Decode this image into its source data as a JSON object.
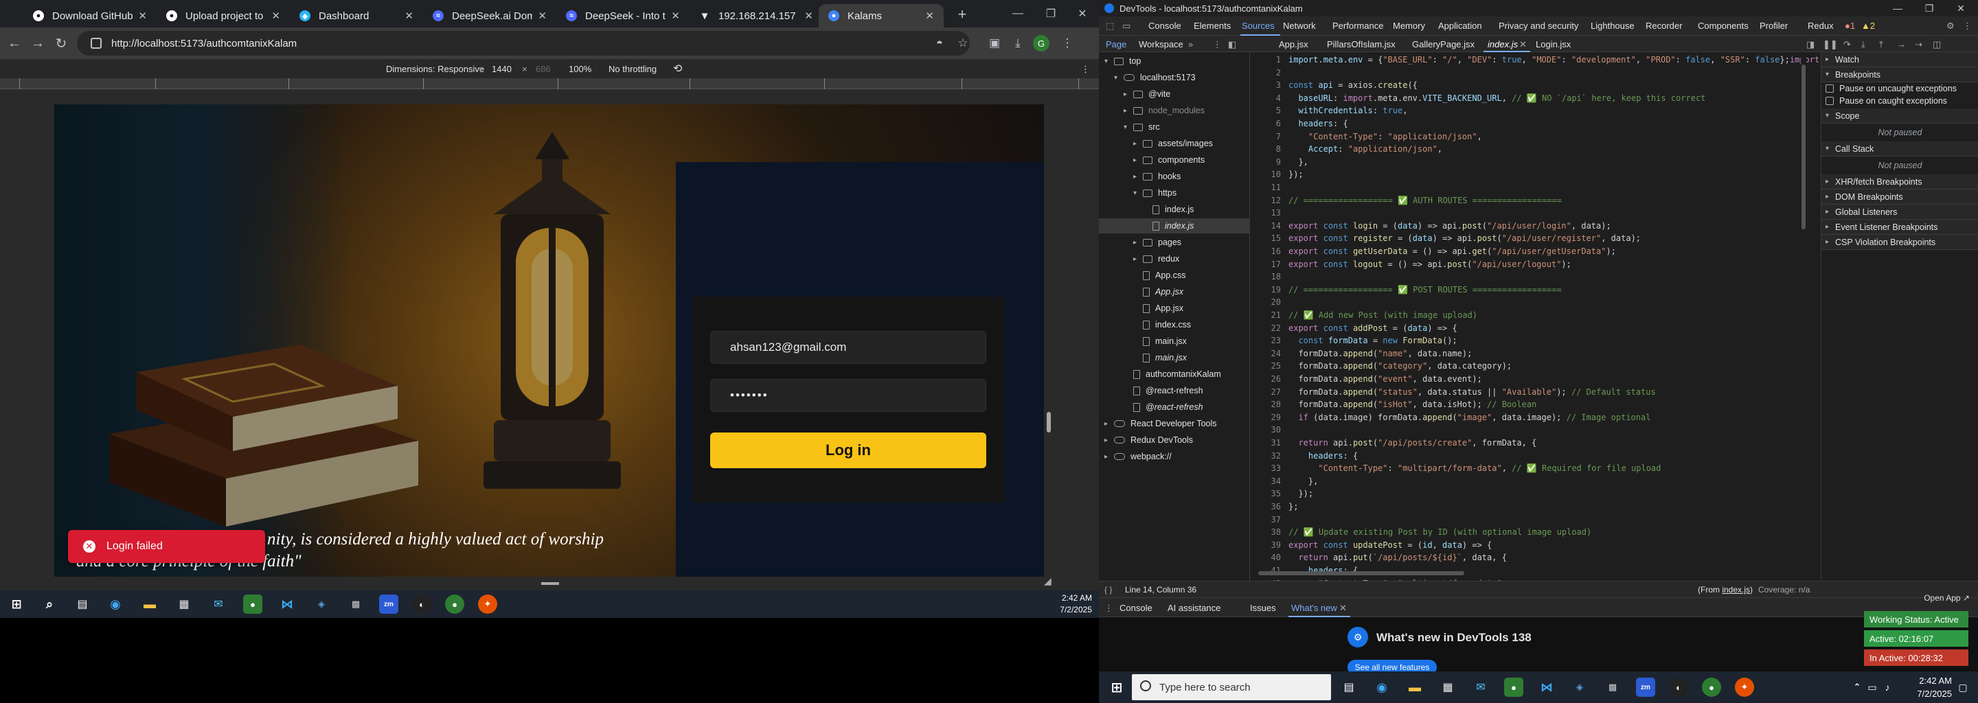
{
  "browser": {
    "tabs": [
      {
        "title": "Download GitHub Des",
        "icon": "github-icon",
        "active": false
      },
      {
        "title": "Upload project to kala",
        "icon": "github-icon",
        "active": false
      },
      {
        "title": "Dashboard",
        "icon": "dashboard-icon",
        "active": false
      },
      {
        "title": "DeepSeek.ai Domain F",
        "icon": "deepseek-icon",
        "active": false
      },
      {
        "title": "DeepSeek - Into the U",
        "icon": "deepseek-icon",
        "active": false
      },
      {
        "title": "192.168.214.157",
        "icon": "wifi-icon",
        "active": false
      },
      {
        "title": "Kalams",
        "icon": "chrome-icon",
        "active": true
      }
    ],
    "new_tab": "+",
    "url": "http://localhost:5173/authcomtanixKalam",
    "profile_initial": "G",
    "emulation": {
      "dimensions": "Dimensions: Responsive",
      "width": "1440",
      "times": "×",
      "height": "686",
      "zoom": "100%",
      "throttling": "No throttling"
    }
  },
  "app": {
    "login": {
      "email_value": "ahsan123@gmail.com",
      "password_value": "•••••••",
      "login_label": "Log in"
    },
    "quote_line1": "nity, is considered a highly valued act of worship",
    "quote_line2": "and a core principle of the faith\"",
    "toast": {
      "icon": "✕",
      "message": "Login failed"
    }
  },
  "left_taskbar": {
    "time": "2:42 AM",
    "date": "7/2/2025"
  },
  "devtools": {
    "window_title": "DevTools - localhost:5173/authcomtanixKalam",
    "panels": [
      "Console",
      "Elements",
      "Sources",
      "Network",
      "Performance",
      "Memory",
      "Application",
      "Privacy and security",
      "Lighthouse",
      "Recorder",
      "Components",
      "Profiler",
      "Redux"
    ],
    "active_panel": "Sources",
    "errors_badge": "1",
    "warnings_badge": "2",
    "nav_tabs": [
      "Page",
      "Workspace"
    ],
    "file_tabs": [
      "App.jsx",
      "PillarsOfIslam.jsx",
      "GalleryPage.jsx",
      "index.js",
      "Login.jsx"
    ],
    "active_file": "index.js",
    "tree": [
      {
        "label": "top",
        "depth": 0,
        "kind": "frame",
        "arrow": "▾"
      },
      {
        "label": "localhost:5173",
        "depth": 1,
        "kind": "cloud",
        "arrow": "▾"
      },
      {
        "label": "@vite",
        "depth": 2,
        "kind": "folder",
        "arrow": "▸"
      },
      {
        "label": "node_modules",
        "depth": 2,
        "kind": "folder",
        "arrow": "▸",
        "dim": true
      },
      {
        "label": "src",
        "depth": 2,
        "kind": "folder",
        "arrow": "▾"
      },
      {
        "label": "assets/images",
        "depth": 3,
        "kind": "folder",
        "arrow": "▸"
      },
      {
        "label": "components",
        "depth": 3,
        "kind": "folder",
        "arrow": "▸"
      },
      {
        "label": "hooks",
        "depth": 3,
        "kind": "folder",
        "arrow": "▸"
      },
      {
        "label": "https",
        "depth": 3,
        "kind": "folder",
        "arrow": "▾"
      },
      {
        "label": "index.js",
        "depth": 4,
        "kind": "file"
      },
      {
        "label": "index.js",
        "depth": 4,
        "kind": "file",
        "italic": true,
        "selected": true
      },
      {
        "label": "pages",
        "depth": 3,
        "kind": "folder",
        "arrow": "▸"
      },
      {
        "label": "redux",
        "depth": 3,
        "kind": "folder",
        "arrow": "▸"
      },
      {
        "label": "App.css",
        "depth": 3,
        "kind": "file"
      },
      {
        "label": "App.jsx",
        "depth": 3,
        "kind": "file",
        "italic": true
      },
      {
        "label": "App.jsx",
        "depth": 3,
        "kind": "file"
      },
      {
        "label": "index.css",
        "depth": 3,
        "kind": "file"
      },
      {
        "label": "main.jsx",
        "depth": 3,
        "kind": "file"
      },
      {
        "label": "main.jsx",
        "depth": 3,
        "kind": "file",
        "italic": true
      },
      {
        "label": "authcomtanixKalam",
        "depth": 2,
        "kind": "file"
      },
      {
        "label": "@react-refresh",
        "depth": 2,
        "kind": "file"
      },
      {
        "label": "@react-refresh",
        "depth": 2,
        "kind": "file",
        "italic": true
      },
      {
        "label": "React Developer Tools",
        "depth": 0,
        "kind": "cloud",
        "arrow": "▸"
      },
      {
        "label": "Redux DevTools",
        "depth": 0,
        "kind": "cloud",
        "arrow": "▸"
      },
      {
        "label": "webpack://",
        "depth": 0,
        "kind": "cloud",
        "arrow": "▸"
      }
    ],
    "code": [
      [
        [
          "v",
          "import"
        ],
        [
          "g",
          "."
        ],
        [
          "v",
          "meta"
        ],
        [
          "g",
          "."
        ],
        [
          "v",
          "env"
        ],
        [
          "g",
          " = {"
        ],
        [
          "s",
          "\"BASE_URL\""
        ],
        [
          "g",
          ": "
        ],
        [
          "s",
          "\"/\""
        ],
        [
          "g",
          ", "
        ],
        [
          "s",
          "\"DEV\""
        ],
        [
          "g",
          ": "
        ],
        [
          "b",
          "true"
        ],
        [
          "g",
          ", "
        ],
        [
          "s",
          "\"MODE\""
        ],
        [
          "g",
          ": "
        ],
        [
          "s",
          "\"development\""
        ],
        [
          "g",
          ", "
        ],
        [
          "s",
          "\"PROD\""
        ],
        [
          "g",
          ": "
        ],
        [
          "b",
          "false"
        ],
        [
          "g",
          ", "
        ],
        [
          "s",
          "\"SSR\""
        ],
        [
          "g",
          ": "
        ],
        [
          "b",
          "false"
        ],
        [
          "g",
          "};"
        ],
        [
          "k",
          "import"
        ],
        [
          "g",
          " axios "
        ]
      ],
      [],
      [
        [
          "b",
          "const"
        ],
        [
          "g",
          " "
        ],
        [
          "v",
          "api"
        ],
        [
          "g",
          " = axios."
        ],
        [
          "f",
          "create"
        ],
        [
          "g",
          "({"
        ]
      ],
      [
        [
          "g",
          "  "
        ],
        [
          "v",
          "baseURL"
        ],
        [
          "g",
          ": "
        ],
        [
          "k",
          "import"
        ],
        [
          "g",
          ".meta.env."
        ],
        [
          "v",
          "VITE_BACKEND_URL"
        ],
        [
          "g",
          ", "
        ],
        [
          "c",
          "// ✅ NO `/api` here, keep this correct"
        ]
      ],
      [
        [
          "g",
          "  "
        ],
        [
          "v",
          "withCredentials"
        ],
        [
          "g",
          ": "
        ],
        [
          "b",
          "true"
        ],
        [
          "g",
          ","
        ]
      ],
      [
        [
          "g",
          "  "
        ],
        [
          "v",
          "headers"
        ],
        [
          "g",
          ": {"
        ]
      ],
      [
        [
          "g",
          "    "
        ],
        [
          "s",
          "\"Content-Type\""
        ],
        [
          "g",
          ": "
        ],
        [
          "s",
          "\"application/json\""
        ],
        [
          "g",
          ","
        ]
      ],
      [
        [
          "g",
          "    "
        ],
        [
          "v",
          "Accept"
        ],
        [
          "g",
          ": "
        ],
        [
          "s",
          "\"application/json\""
        ],
        [
          "g",
          ","
        ]
      ],
      [
        [
          "g",
          "  },"
        ]
      ],
      [
        [
          "g",
          "});"
        ]
      ],
      [],
      [
        [
          "c",
          "// ================== ✅ AUTH ROUTES =================="
        ]
      ],
      [],
      [
        [
          "k",
          "export"
        ],
        [
          "g",
          " "
        ],
        [
          "b",
          "const"
        ],
        [
          "g",
          " "
        ],
        [
          "f",
          "login"
        ],
        [
          "g",
          " = ("
        ],
        [
          "v",
          "data"
        ],
        [
          "g",
          ") => api."
        ],
        [
          "f",
          "post"
        ],
        [
          "g",
          "("
        ],
        [
          "s",
          "\"/api/user/login\""
        ],
        [
          "g",
          ", data);"
        ]
      ],
      [
        [
          "k",
          "export"
        ],
        [
          "g",
          " "
        ],
        [
          "b",
          "const"
        ],
        [
          "g",
          " "
        ],
        [
          "f",
          "register"
        ],
        [
          "g",
          " = ("
        ],
        [
          "v",
          "data"
        ],
        [
          "g",
          ") => api."
        ],
        [
          "f",
          "post"
        ],
        [
          "g",
          "("
        ],
        [
          "s",
          "\"/api/user/register\""
        ],
        [
          "g",
          ", data);"
        ]
      ],
      [
        [
          "k",
          "export"
        ],
        [
          "g",
          " "
        ],
        [
          "b",
          "const"
        ],
        [
          "g",
          " "
        ],
        [
          "f",
          "getUserData"
        ],
        [
          "g",
          " = () => api."
        ],
        [
          "f",
          "get"
        ],
        [
          "g",
          "("
        ],
        [
          "s",
          "\"/api/user/getUserData\""
        ],
        [
          "g",
          ");"
        ]
      ],
      [
        [
          "k",
          "export"
        ],
        [
          "g",
          " "
        ],
        [
          "b",
          "const"
        ],
        [
          "g",
          " "
        ],
        [
          "f",
          "logout"
        ],
        [
          "g",
          " = () => api."
        ],
        [
          "f",
          "post"
        ],
        [
          "g",
          "("
        ],
        [
          "s",
          "\"/api/user/logout\""
        ],
        [
          "g",
          ");"
        ]
      ],
      [],
      [
        [
          "c",
          "// ================== ✅ POST ROUTES =================="
        ]
      ],
      [],
      [
        [
          "c",
          "// ✅ Add new Post (with image upload)"
        ]
      ],
      [
        [
          "k",
          "export"
        ],
        [
          "g",
          " "
        ],
        [
          "b",
          "const"
        ],
        [
          "g",
          " "
        ],
        [
          "f",
          "addPost"
        ],
        [
          "g",
          " = ("
        ],
        [
          "v",
          "data"
        ],
        [
          "g",
          ") => {"
        ]
      ],
      [
        [
          "g",
          "  "
        ],
        [
          "b",
          "const"
        ],
        [
          "g",
          " "
        ],
        [
          "v",
          "formData"
        ],
        [
          "g",
          " = "
        ],
        [
          "b",
          "new"
        ],
        [
          "g",
          " "
        ],
        [
          "f",
          "FormData"
        ],
        [
          "g",
          "();"
        ]
      ],
      [
        [
          "g",
          "  formData."
        ],
        [
          "f",
          "append"
        ],
        [
          "g",
          "("
        ],
        [
          "s",
          "\"name\""
        ],
        [
          "g",
          ", data.name);"
        ]
      ],
      [
        [
          "g",
          "  formData."
        ],
        [
          "f",
          "append"
        ],
        [
          "g",
          "("
        ],
        [
          "s",
          "\"category\""
        ],
        [
          "g",
          ", data.category);"
        ]
      ],
      [
        [
          "g",
          "  formData."
        ],
        [
          "f",
          "append"
        ],
        [
          "g",
          "("
        ],
        [
          "s",
          "\"event\""
        ],
        [
          "g",
          ", data.event);"
        ]
      ],
      [
        [
          "g",
          "  formData."
        ],
        [
          "f",
          "append"
        ],
        [
          "g",
          "("
        ],
        [
          "s",
          "\"status\""
        ],
        [
          "g",
          ", data.status || "
        ],
        [
          "s",
          "\"Available\""
        ],
        [
          "g",
          "); "
        ],
        [
          "c",
          "// Default status"
        ]
      ],
      [
        [
          "g",
          "  formData."
        ],
        [
          "f",
          "append"
        ],
        [
          "g",
          "("
        ],
        [
          "s",
          "\"isHot\""
        ],
        [
          "g",
          ", data.isHot); "
        ],
        [
          "c",
          "// Boolean"
        ]
      ],
      [
        [
          "g",
          "  "
        ],
        [
          "k",
          "if"
        ],
        [
          "g",
          " (data.image) formData."
        ],
        [
          "f",
          "append"
        ],
        [
          "g",
          "("
        ],
        [
          "s",
          "\"image\""
        ],
        [
          "g",
          ", data.image); "
        ],
        [
          "c",
          "// Image optional"
        ]
      ],
      [],
      [
        [
          "g",
          "  "
        ],
        [
          "k",
          "return"
        ],
        [
          "g",
          " api."
        ],
        [
          "f",
          "post"
        ],
        [
          "g",
          "("
        ],
        [
          "s",
          "\"/api/posts/create\""
        ],
        [
          "g",
          ", formData, {"
        ]
      ],
      [
        [
          "g",
          "    "
        ],
        [
          "v",
          "headers"
        ],
        [
          "g",
          ": {"
        ]
      ],
      [
        [
          "g",
          "      "
        ],
        [
          "s",
          "\"Content-Type\""
        ],
        [
          "g",
          ": "
        ],
        [
          "s",
          "\"multipart/form-data\""
        ],
        [
          "g",
          ", "
        ],
        [
          "c",
          "// ✅ Required for file upload"
        ]
      ],
      [
        [
          "g",
          "    },"
        ]
      ],
      [
        [
          "g",
          "  });"
        ]
      ],
      [
        [
          "g",
          "};"
        ]
      ],
      [],
      [
        [
          "c",
          "// ✅ Update existing Post by ID (with optional image upload)"
        ]
      ],
      [
        [
          "k",
          "export"
        ],
        [
          "g",
          " "
        ],
        [
          "b",
          "const"
        ],
        [
          "g",
          " "
        ],
        [
          "f",
          "updatePost"
        ],
        [
          "g",
          " = ("
        ],
        [
          "v",
          "id"
        ],
        [
          "g",
          ", "
        ],
        [
          "v",
          "data"
        ],
        [
          "g",
          ") => {"
        ]
      ],
      [
        [
          "g",
          "  "
        ],
        [
          "k",
          "return"
        ],
        [
          "g",
          " api."
        ],
        [
          "f",
          "put"
        ],
        [
          "g",
          "("
        ],
        [
          "s",
          "`/api/posts/${id}`"
        ],
        [
          "g",
          ", data, {"
        ]
      ],
      [
        [
          "g",
          "    "
        ],
        [
          "v",
          "headers"
        ],
        [
          "g",
          ": {"
        ]
      ],
      [
        [
          "g",
          "      "
        ],
        [
          "s",
          "\"Content-Type\""
        ],
        [
          "g",
          ": "
        ],
        [
          "s",
          "\"multipart/form-data\""
        ],
        [
          "g",
          ","
        ]
      ],
      [
        [
          "g",
          "    },"
        ]
      ],
      [
        [
          "g",
          "  });"
        ]
      ]
    ],
    "status_left": "Line 14, Column 36",
    "status_right_from": "(From ",
    "status_right_file": "index.js",
    "status_right_close": ")",
    "status_coverage": "Coverage: n/a",
    "debugger": {
      "watch": "Watch",
      "breakpoints": "Breakpoints",
      "pause_uncaught": "Pause on uncaught exceptions",
      "pause_caught": "Pause on caught exceptions",
      "scope": "Scope",
      "not_paused_1": "Not paused",
      "call_stack": "Call Stack",
      "not_paused_2": "Not paused",
      "sections": [
        "XHR/fetch Breakpoints",
        "DOM Breakpoints",
        "Global Listeners",
        "Event Listener Breakpoints",
        "CSP Violation Breakpoints"
      ]
    },
    "drawer_tabs": [
      "Console",
      "AI assistance",
      "Issues",
      "What's new"
    ],
    "active_drawer": "What's new",
    "whats_new_title": "What's new in DevTools 138",
    "whats_new_button": "See all new features"
  },
  "widgets": {
    "open_app": "Open App ↗",
    "working": "Working Status: Active",
    "active": "Active: 02:16:07",
    "inactive": "In Active: 00:28:32",
    "colors": {
      "working": "#2e8b3e",
      "active": "#2f9a45",
      "inactive": "#c0392b"
    }
  },
  "right_taskbar": {
    "search_placeholder": "Type here to search",
    "time": "2:42 AM",
    "date": "7/2/2025"
  }
}
